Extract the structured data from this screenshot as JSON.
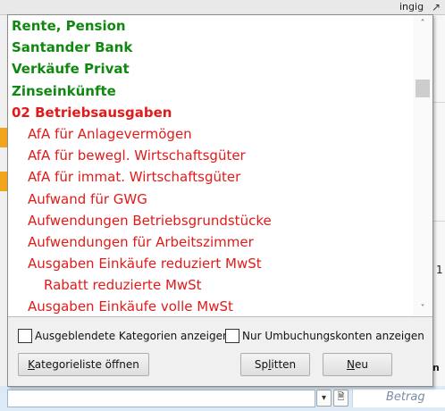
{
  "background": {
    "tab_fragment": "ingig",
    "corner_icon": "export-icon",
    "side_digit": "1",
    "side_label": "n",
    "amount_placeholder": "Betrag"
  },
  "category_list": {
    "items": [
      {
        "label": "Rente, Pension",
        "style": "green"
      },
      {
        "label": "Santander Bank",
        "style": "green"
      },
      {
        "label": "Verkäufe Privat",
        "style": "green"
      },
      {
        "label": "Zinseinkünfte",
        "style": "green"
      },
      {
        "label": "02 Betriebsausgaben",
        "style": "red-head"
      },
      {
        "label": "AfA für Anlagevermögen",
        "style": "red"
      },
      {
        "label": "AfA für bewegl. Wirtschaftsgüter",
        "style": "red"
      },
      {
        "label": "AfA für immat. Wirtschaftsgüter",
        "style": "red"
      },
      {
        "label": "Aufwand für GWG",
        "style": "red"
      },
      {
        "label": "Aufwendungen Betriebsgrundstücke",
        "style": "red"
      },
      {
        "label": "Aufwendungen für Arbeitszimmer",
        "style": "red"
      },
      {
        "label": "Ausgaben Einkäufe reduziert MwSt",
        "style": "red"
      },
      {
        "label": "Rabatt reduzierte MwSt",
        "style": "red-sub"
      },
      {
        "label": "Ausgaben Einkäufe volle MwSt",
        "style": "red"
      }
    ],
    "colors": {
      "income_green": "#118811",
      "expense_red": "#e21a1a"
    }
  },
  "options": {
    "show_hidden_label": "Ausgeblendete Kategorien anzeigen",
    "show_hidden_checked": false,
    "only_rebooking_label": "Nur Umbuchungskonten anzeigen",
    "only_rebooking_checked": false
  },
  "buttons": {
    "open_list_prefix": "",
    "open_list_mnemonic": "K",
    "open_list_rest": "ategorieliste öffnen",
    "split_prefix": "Sp",
    "split_mnemonic": "l",
    "split_rest": "itten",
    "new_prefix": "",
    "new_mnemonic": "N",
    "new_rest": "eu"
  }
}
